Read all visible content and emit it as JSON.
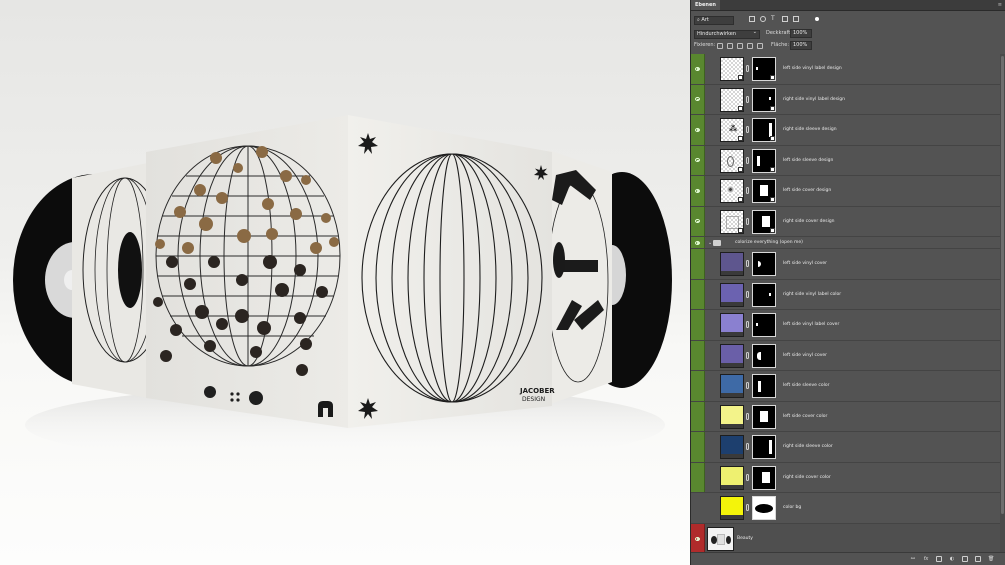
{
  "panel": {
    "tab_title": "Ebenen",
    "filter": {
      "kind_label": "Art",
      "icons": [
        "pixel-filter-icon",
        "adjustment-filter-icon",
        "type-filter-icon",
        "shape-filter-icon",
        "smart-object-filter-icon"
      ]
    },
    "blend_mode": "Hindurchwirken",
    "opacity_label": "Deckkraft:",
    "opacity_value": "100%",
    "lock_label": "Fixieren:",
    "fill_label": "Fläche:",
    "fill_value": "100%"
  },
  "layers": [
    {
      "name": "left side vinyl label design",
      "type": "smart",
      "visibility": "green",
      "thumb": "checker",
      "mask": "dot"
    },
    {
      "name": "right side vinyl label design",
      "type": "smart",
      "visibility": "green",
      "thumb": "checker",
      "mask": "dot"
    },
    {
      "name": "right side sleeve design",
      "type": "smart",
      "visibility": "green",
      "thumb": "checker",
      "mask": "right-strip"
    },
    {
      "name": "left side sleeve design",
      "type": "smart",
      "visibility": "green",
      "thumb": "checker",
      "mask": "left-strip"
    },
    {
      "name": "left side cover design",
      "type": "smart",
      "visibility": "green",
      "thumb": "checker",
      "mask": "square"
    },
    {
      "name": "right side cover design",
      "type": "smart",
      "visibility": "green",
      "thumb": "checker",
      "mask": "square"
    },
    {
      "name": "colorize everything (open me)",
      "type": "group",
      "visibility": "green"
    },
    {
      "name": "left side vinyl cover",
      "type": "fill",
      "visibility": "green",
      "color": "#5e568e",
      "mask": "half-dot"
    },
    {
      "name": "right side vinyl label color",
      "type": "fill",
      "visibility": "green",
      "color": "#6b62b0",
      "mask": "dot"
    },
    {
      "name": "left side vinyl label cover",
      "type": "fill",
      "visibility": "green",
      "color": "#8a80d0",
      "mask": "dot"
    },
    {
      "name": "left side vinyl cover",
      "type": "fill",
      "visibility": "green",
      "color": "#6a5fa8",
      "mask": "half-dot"
    },
    {
      "name": "left side sleeve color",
      "type": "fill",
      "visibility": "green",
      "color": "#3e6aa6",
      "mask": "left-strip"
    },
    {
      "name": "left side cover color",
      "type": "fill",
      "visibility": "green",
      "color": "#f3f38a",
      "mask": "square"
    },
    {
      "name": "right side sleeve color",
      "type": "fill",
      "visibility": "green",
      "color": "#1d3f6e",
      "mask": "right-strip"
    },
    {
      "name": "right side cover color",
      "type": "fill",
      "visibility": "green",
      "color": "#eef070",
      "mask": "square"
    },
    {
      "name": "color bg",
      "type": "fill",
      "visibility": "grey",
      "color": "#f4f40a",
      "mask": "blob"
    },
    {
      "name": "Beauty",
      "type": "background",
      "visibility": "red"
    }
  ],
  "mockup": {
    "left_cover_brand_mark": "m",
    "right_cover_brand_line1": "JACOBER",
    "right_cover_brand_line2": "DESIGN"
  },
  "footer_icons": [
    "link-layers-icon",
    "fx-icon",
    "add-mask-icon",
    "adjustment-layer-icon",
    "new-group-icon",
    "new-layer-icon",
    "delete-layer-icon"
  ]
}
